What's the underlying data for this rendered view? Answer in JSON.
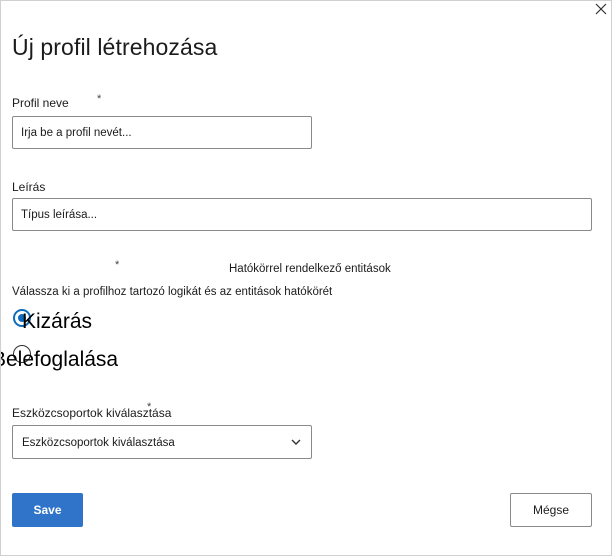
{
  "dialog": {
    "title": "Új profil létrehozása"
  },
  "profile_name": {
    "label": "Profil neve",
    "required_mark": "*",
    "placeholder": "Írja be a profil nevét..."
  },
  "description": {
    "label": "Leírás",
    "placeholder": "Típus leírása..."
  },
  "scope": {
    "required_mark": "*",
    "scoped_entities_label": "Hatókörrel rendelkező entitások",
    "instruction": "Válassza ki a profilhoz tartozó logikát és az entitások hatókörét",
    "options": [
      {
        "label": "Kizárás",
        "checked": true
      },
      {
        "label": "Belefoglalása",
        "checked": false
      }
    ]
  },
  "device_groups": {
    "label": "Eszközcsoportok kiválasztása",
    "required_mark": "*",
    "selected_value": "Eszközcsoportok kiválasztása"
  },
  "actions": {
    "save_label": "Save",
    "cancel_label": "Mégse"
  },
  "colors": {
    "primary": "#2f74c8",
    "radio_accent": "#0f6cbd",
    "border": "#8a8a8a"
  },
  "icons": {
    "close": "close-icon",
    "chevron": "chevron-down-icon"
  }
}
